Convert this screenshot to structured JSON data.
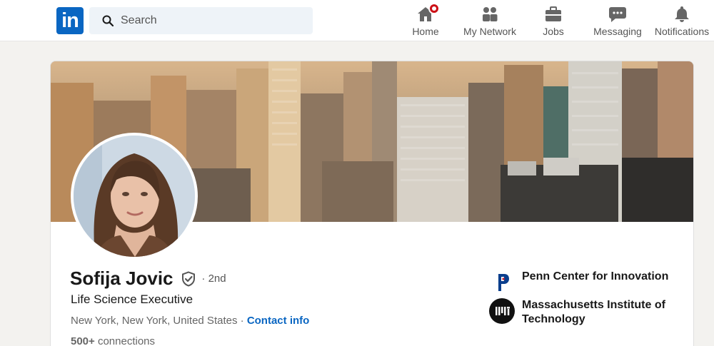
{
  "nav": {
    "logo_text": "in",
    "search": {
      "placeholder": "Search"
    },
    "items": [
      {
        "label": "Home",
        "icon": "home-icon",
        "has_badge": true
      },
      {
        "label": "My Network",
        "icon": "people-icon"
      },
      {
        "label": "Jobs",
        "icon": "briefcase-icon"
      },
      {
        "label": "Messaging",
        "icon": "chat-icon"
      },
      {
        "label": "Notifications",
        "icon": "bell-icon"
      }
    ]
  },
  "profile": {
    "name": "Sofija Jovic",
    "degree": "· 2nd",
    "headline": "Life Science Executive",
    "location": "New York, New York, United States",
    "separator": " · ",
    "contact_label": "Contact info",
    "connections_count": "500+",
    "connections_label": " connections"
  },
  "organizations": [
    {
      "name": "Penn Center for Innovation",
      "icon": "penn-logo-icon"
    },
    {
      "name": "Massachusetts Institute of Technology",
      "icon": "mit-logo-icon"
    }
  ],
  "colors": {
    "brand": "#0a66c2",
    "badge": "#cc1016",
    "background": "#f3f2ef"
  }
}
